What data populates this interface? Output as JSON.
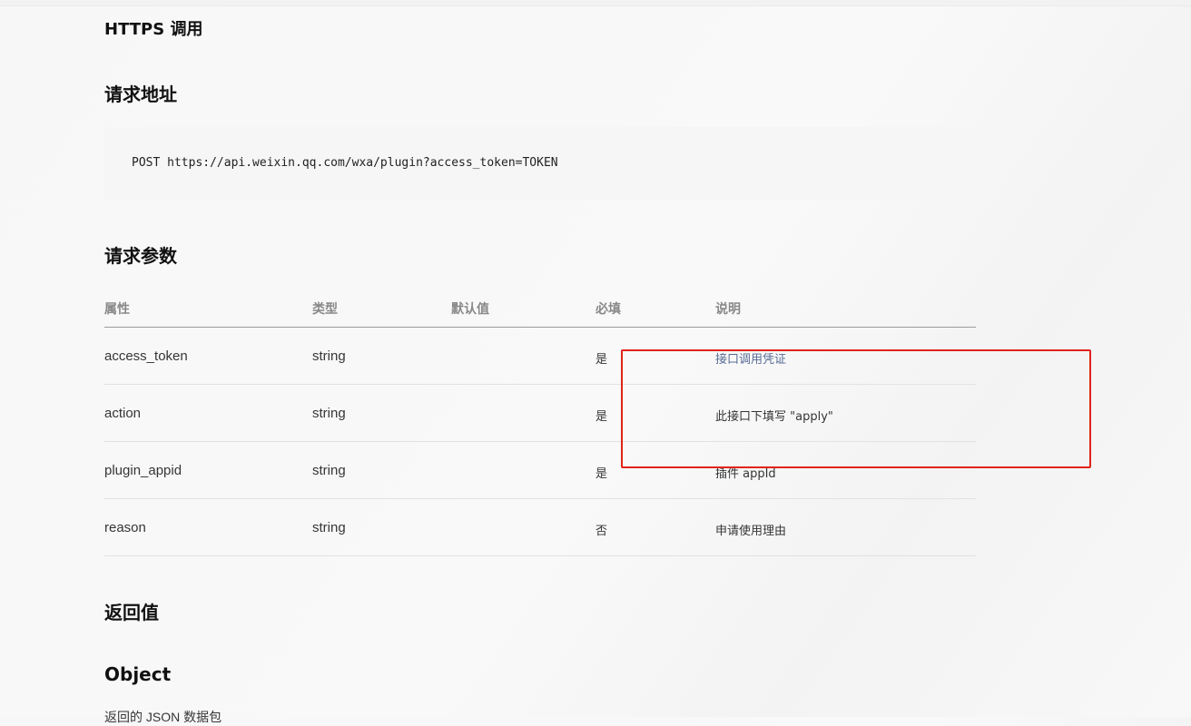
{
  "headings": {
    "https_call": "HTTPS 调用",
    "request_url": "请求地址",
    "request_params": "请求参数",
    "return_value": "返回值",
    "object": "Object"
  },
  "code": {
    "request_line": "POST https://api.weixin.qq.com/wxa/plugin?access_token=TOKEN"
  },
  "params_table": {
    "headers": {
      "attr": "属性",
      "type": "类型",
      "default": "默认值",
      "required": "必填",
      "desc": "说明"
    },
    "rows": [
      {
        "attr": "access_token",
        "type": "string",
        "default": "",
        "required": "是",
        "desc": "接口调用凭证"
      },
      {
        "attr": "action",
        "type": "string",
        "default": "",
        "required": "是",
        "desc": "此接口下填写 \"apply\""
      },
      {
        "attr": "plugin_appid",
        "type": "string",
        "default": "",
        "required": "是",
        "desc": "插件 appId"
      },
      {
        "attr": "reason",
        "type": "string",
        "default": "",
        "required": "否",
        "desc": "申请使用理由"
      }
    ]
  },
  "return_desc": "返回的 JSON 数据包",
  "colors": {
    "highlight_border": "#e0241b",
    "link": "#576b95",
    "heading": "#111111"
  }
}
